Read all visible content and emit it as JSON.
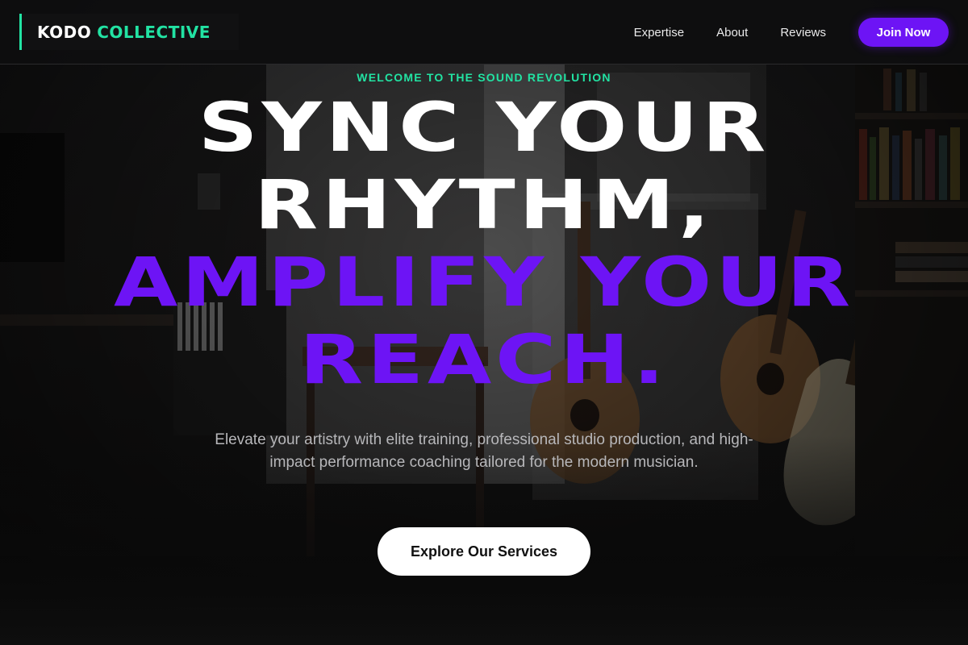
{
  "brand": {
    "part1": "KODO",
    "part2": "COLLECTIVE"
  },
  "nav": {
    "items": [
      "Expertise",
      "About",
      "Reviews"
    ],
    "cta": "Join Now"
  },
  "hero": {
    "eyebrow": "WELCOME TO THE SOUND REVOLUTION",
    "headline": [
      "SYNC YOUR",
      "RHYTHM,",
      "AMPLIFY YOUR",
      "REACH."
    ],
    "subtitle": "Elevate your artistry with elite training, professional studio production, and high-impact performance coaching tailored for the modern musician.",
    "cta": "Explore Our Services"
  },
  "colors": {
    "accent_green": "#22e3a3",
    "accent_purple": "#6d14f5",
    "background": "#0b0b0c"
  }
}
